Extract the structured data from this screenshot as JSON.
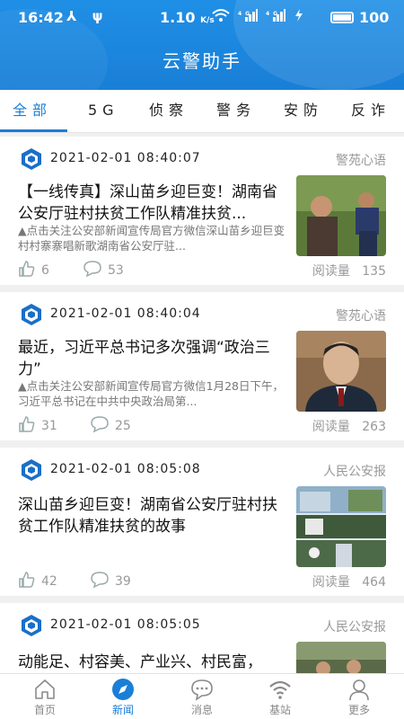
{
  "status_bar": {
    "time": "16:42",
    "speed": "1.10",
    "speed_unit": "K/s",
    "battery": "100"
  },
  "app_title": "云警助手",
  "tabs": [
    {
      "label": "全部",
      "active": true
    },
    {
      "label": "5G",
      "active": false
    },
    {
      "label": "侦察",
      "active": false
    },
    {
      "label": "警务",
      "active": false
    },
    {
      "label": "安防",
      "active": false
    },
    {
      "label": "反诈",
      "active": false
    }
  ],
  "feed": [
    {
      "date": "2021-02-01  08:40:07",
      "source": "警苑心语",
      "title": "【一线传真】深山苗乡迎巨变！湖南省公安厅驻村扶贫工作队精准扶贫...",
      "desc": "▲点击关注公安部新闻宣传局官方微信深山苗乡迎巨变  村村寨寨唱新歌湖南省公安厅驻...",
      "likes": "6",
      "comments": "53",
      "reads_label": "阅读量",
      "reads": "135",
      "thumb": "village-officers-photo"
    },
    {
      "date": "2021-02-01  08:40:04",
      "source": "警苑心语",
      "title": "最近，习近平总书记多次强调“政治三力”",
      "desc": "▲点击关注公安部新闻宣传局官方微信1月28日下午，习近平总书记在中共中央政治局第...",
      "likes": "31",
      "comments": "25",
      "reads_label": "阅读量",
      "reads": "263",
      "thumb": "portrait-photo"
    },
    {
      "date": "2021-02-01  08:05:08",
      "source": "人民公安报",
      "title": "深山苗乡迎巨变！湖南省公安厅驻村扶贫工作队精准扶贫的故事",
      "desc": "",
      "likes": "42",
      "comments": "39",
      "reads_label": "阅读量",
      "reads": "464",
      "thumb": "collage-photo"
    },
    {
      "date": "2021-02-01  08:05:05",
      "source": "人民公安报",
      "title": "动能足、村容美、产业兴、村民富，",
      "desc": "",
      "likes": "",
      "comments": "",
      "reads_label": "",
      "reads": "",
      "thumb": "group-photo"
    }
  ],
  "bottom_nav": [
    {
      "label": "首页",
      "icon": "home-icon",
      "active": false
    },
    {
      "label": "新闻",
      "icon": "compass-icon",
      "active": true
    },
    {
      "label": "消息",
      "icon": "message-icon",
      "active": false
    },
    {
      "label": "基站",
      "icon": "wifi-icon",
      "active": false
    },
    {
      "label": "更多",
      "icon": "user-icon",
      "active": false
    }
  ],
  "colors": {
    "accent": "#1a7fd6",
    "muted": "#999999"
  }
}
